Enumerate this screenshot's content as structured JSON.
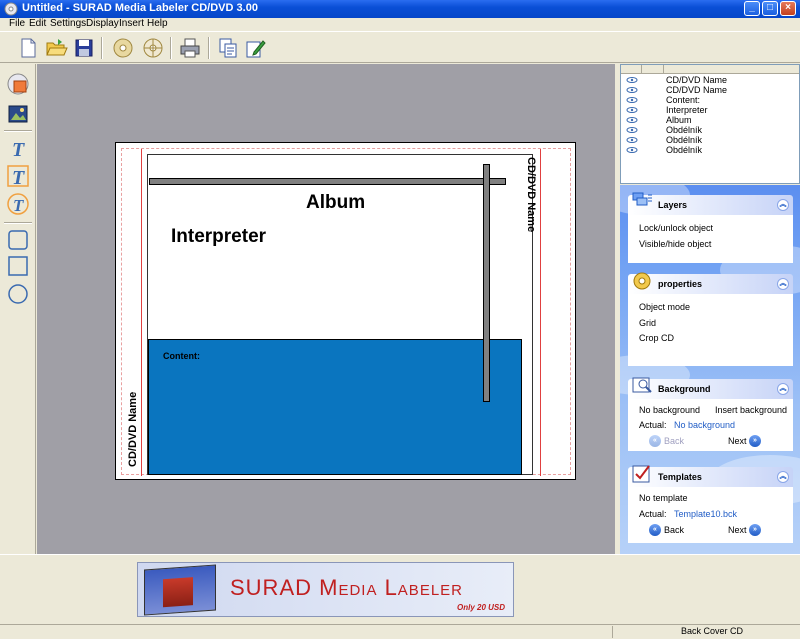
{
  "window": {
    "title": "Untitled - SURAD Media Labeler CD/DVD 3.00",
    "minimize": "_",
    "maximize": "□",
    "close": "×"
  },
  "menu": [
    "File",
    "Edit",
    "Settings",
    "Display",
    "Insert",
    "Help"
  ],
  "toolbar": {
    "icons": [
      "new-document-icon",
      "open-folder-icon",
      "save-icon",
      "cd-icon",
      "cd-label-icon",
      "print-icon",
      "copy-icon",
      "edit-icon"
    ]
  },
  "tools": {
    "icons": [
      "image-tool-icon",
      "picture-tool-icon",
      "text-tool-icon",
      "text-frame-tool-icon",
      "circular-text-tool-icon",
      "rounded-rectangle-tool-icon",
      "rectangle-tool-icon",
      "ellipse-tool-icon"
    ]
  },
  "label": {
    "album": "Album",
    "interpreter": "Interpreter",
    "content": "Content:",
    "spine_right": "CD/DVD Name",
    "spine_left": "CD/DVD Name",
    "panel_color": "#0a75bf"
  },
  "objects": [
    "CD/DVD Name",
    "CD/DVD Name",
    "Content:",
    "Interpreter",
    "Album",
    "Obdélník",
    "Obdélník",
    "Obdélník"
  ],
  "panels": {
    "layers": {
      "title": "Layers",
      "items": [
        "Lock/unlock object",
        "Visible/hide object"
      ]
    },
    "properties": {
      "title": "properties",
      "items": [
        "Object mode",
        "Grid",
        "Crop CD"
      ]
    },
    "background": {
      "title": "Background",
      "no_background": "No background",
      "insert_background": "Insert background",
      "actual_label": "Actual:",
      "actual_value": "No background",
      "back": "Back",
      "next": "Next"
    },
    "templates": {
      "title": "Templates",
      "no_template": "No template",
      "actual_label": "Actual:",
      "actual_value": "Template10.bck",
      "back": "Back",
      "next": "Next"
    }
  },
  "banner": {
    "name": "SURAD Media Labeler",
    "price": "Only 20 USD"
  },
  "status": {
    "mode": "Back Cover CD"
  }
}
